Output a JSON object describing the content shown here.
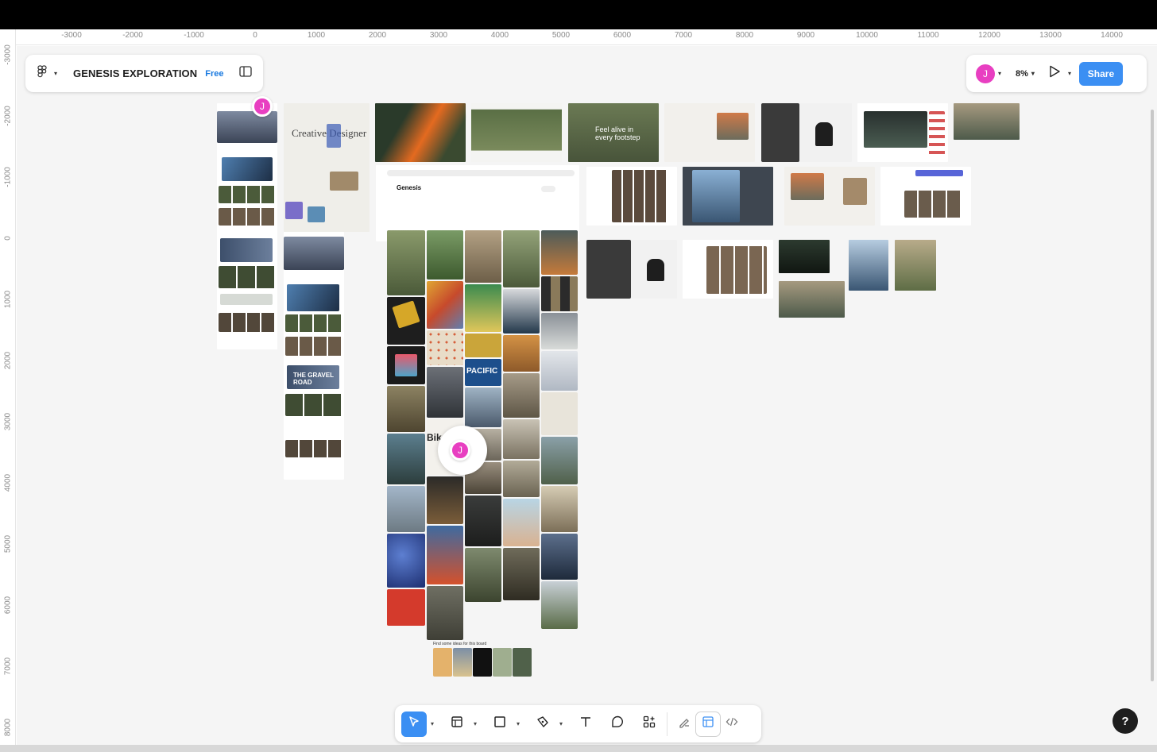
{
  "file": {
    "title": "GENESIS EXPLORATION",
    "plan": "Free"
  },
  "rulers": {
    "horizontal": [
      "-3000",
      "-2000",
      "-1000",
      "0",
      "1000",
      "2000",
      "3000",
      "4000",
      "5000",
      "6000",
      "7000",
      "8000",
      "9000",
      "10000",
      "11000",
      "12000",
      "13000",
      "14000"
    ],
    "vertical": [
      "-3000",
      "-2000",
      "-1000",
      "0",
      "1000",
      "2000",
      "3000",
      "4000",
      "5000",
      "6000",
      "7000",
      "8000"
    ]
  },
  "header_right": {
    "user_initial": "J",
    "zoom": "8%",
    "share_label": "Share"
  },
  "collaborators": [
    "J",
    "J",
    "J"
  ],
  "frames": {
    "creative_title": "Creative Designer",
    "footstep_text": "Feel alive in every footstep",
    "board_title": "Genesis",
    "pacific_badge": "PACIFIC",
    "bike_text": "Bike Pa",
    "gravel_text": "THE GRAVEL ROAD",
    "gravel_text_2": "THE GRAVEL ROAD",
    "ideas_caption": "Find some ideas for this board"
  },
  "toolbar": {
    "tools": [
      "move-tool",
      "frame-tool",
      "shape-tool",
      "pen-tool",
      "text-tool",
      "comment-tool",
      "actions-tool"
    ],
    "modes": [
      "draw-mode",
      "design-mode",
      "dev-mode"
    ]
  },
  "help_label": "?",
  "colors": {
    "accent": "#3b8ff3",
    "avatar": "#e83fc1"
  }
}
